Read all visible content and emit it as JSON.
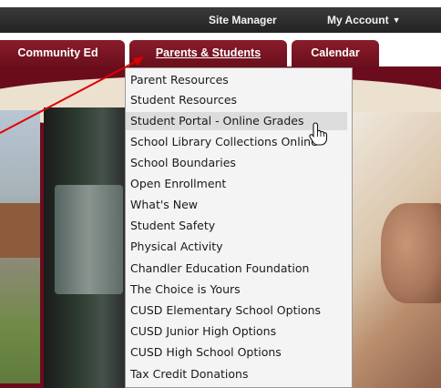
{
  "topbar": {
    "site_manager": "Site Manager",
    "my_account": "My Account"
  },
  "nav": {
    "tabs": [
      {
        "label": "Community Ed"
      },
      {
        "label": "Parents & Students"
      },
      {
        "label": "Calendar"
      }
    ]
  },
  "dropdown": {
    "items": [
      {
        "label": "Parent Resources"
      },
      {
        "label": "Student Resources"
      },
      {
        "label": "Student Portal - Online Grades"
      },
      {
        "label": "School Library Collections Online"
      },
      {
        "label": "School Boundaries"
      },
      {
        "label": "Open Enrollment"
      },
      {
        "label": "What's New"
      },
      {
        "label": "Student Safety"
      },
      {
        "label": "Physical Activity"
      },
      {
        "label": "Chandler Education Foundation"
      },
      {
        "label": "The Choice is Yours"
      },
      {
        "label": "CUSD Elementary School Options"
      },
      {
        "label": "CUSD Junior High Options"
      },
      {
        "label": "CUSD High School Options"
      },
      {
        "label": "Tax Credit Donations"
      }
    ],
    "hovered_item": "Student Portal - Online Grades"
  },
  "colors": {
    "brand_maroon": "#6b0c1c",
    "annotation_arrow": "#e00000"
  },
  "icons": {
    "cursor": "hand-pointer-icon",
    "account_caret": "caret-down-icon"
  }
}
